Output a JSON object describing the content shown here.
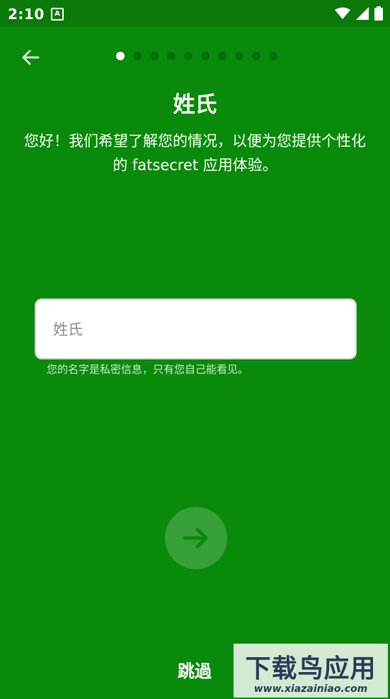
{
  "status_bar": {
    "time": "2:10",
    "notification_badge": "A",
    "icons": [
      "wifi-icon",
      "signal-icon",
      "battery-icon"
    ]
  },
  "progress": {
    "total_steps": 10,
    "current_step": 1
  },
  "page": {
    "title": "姓氏",
    "subtitle": "您好！我们希望了解您的情况，以便为您提供个性化的 fatsecret 应用体验。"
  },
  "form": {
    "last_name_value": "",
    "last_name_placeholder": "姓氏",
    "helper_text": "您的名字是私密信息，只有您自己能看见。"
  },
  "actions": {
    "skip_label": "跳過"
  },
  "watermark": {
    "main": "下载鸟应用",
    "sub": "www.xiazainiao.com"
  },
  "colors": {
    "background": "#0a8a0a",
    "status_bar": "#0b7a0b",
    "next_button": "#38a038",
    "arrow": "#0a8a0a"
  }
}
